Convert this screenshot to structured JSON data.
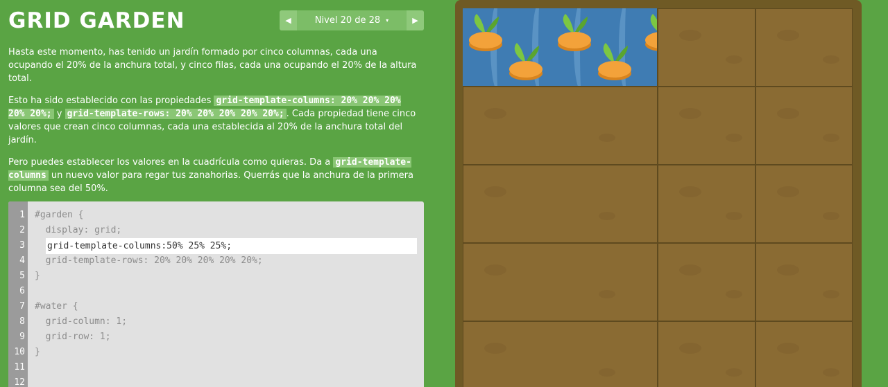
{
  "header": {
    "title": "GRID GARDEN",
    "level_label": "Nivel 20 de 28",
    "prev_glyph": "◀",
    "next_glyph": "▶",
    "caret_glyph": "▾"
  },
  "instructions": {
    "p1": "Hasta este momento, has tenido un jardín formado por cinco columnas, cada una ocupando el 20% de la anchura total, y cinco filas, cada una ocupando el 20% de la altura total.",
    "p2_a": "Esto ha sido establecido con las propiedades ",
    "p2_code1": "grid-template-columns: 20% 20% 20% 20% 20%;",
    "p2_b": " y ",
    "p2_code2": "grid-template-rows: 20% 20% 20% 20% 20%;",
    "p2_c": ". Cada propiedad tiene cinco valores que crean cinco columnas, cada una establecida al 20% de la anchura total del jardín.",
    "p3_a": "Pero puedes establecer los valores en la cuadrícula como quieras. Da a ",
    "p3_code": "grid-template-columns",
    "p3_b": " un nuevo valor para regar tus zanahorias. Querrás que la anchura de la primera columna sea del 50%."
  },
  "editor": {
    "lines": [
      {
        "num": "1",
        "code": "#garden {"
      },
      {
        "num": "2",
        "code": "  display: grid;"
      },
      {
        "num": "3",
        "code": ""
      },
      {
        "num": "4",
        "code": "  grid-template-rows: 20% 20% 20% 20% 20%;"
      },
      {
        "num": "5",
        "code": "}"
      },
      {
        "num": "6",
        "code": ""
      },
      {
        "num": "7",
        "code": "#water {"
      },
      {
        "num": "8",
        "code": "  grid-column: 1;"
      },
      {
        "num": "9",
        "code": "  grid-row: 1;"
      },
      {
        "num": "10",
        "code": "}"
      },
      {
        "num": "11",
        "code": ""
      },
      {
        "num": "12",
        "code": ""
      }
    ],
    "input_value": "grid-template-columns:50% 25% 25%;"
  },
  "colors": {
    "background": "#5aa444",
    "soil": "#8a6b33",
    "water": "#3f7cb3",
    "carrot": "#f0a030",
    "leaf": "#7cc742"
  }
}
